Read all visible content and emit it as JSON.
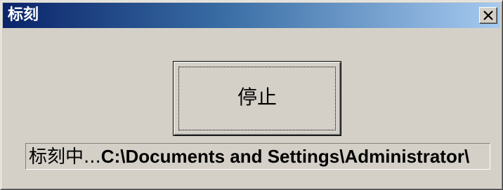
{
  "window": {
    "title": "标刻"
  },
  "titlebar": {
    "close_icon": "close-x-icon"
  },
  "button": {
    "stop_label": "停止"
  },
  "status": {
    "prefix": "标刻中...",
    "path": "C:\\Documents and Settings\\Administrator\\"
  },
  "colors": {
    "face": "#d4d0c8",
    "title_start": "#0a246a",
    "title_end": "#a6caf0"
  }
}
